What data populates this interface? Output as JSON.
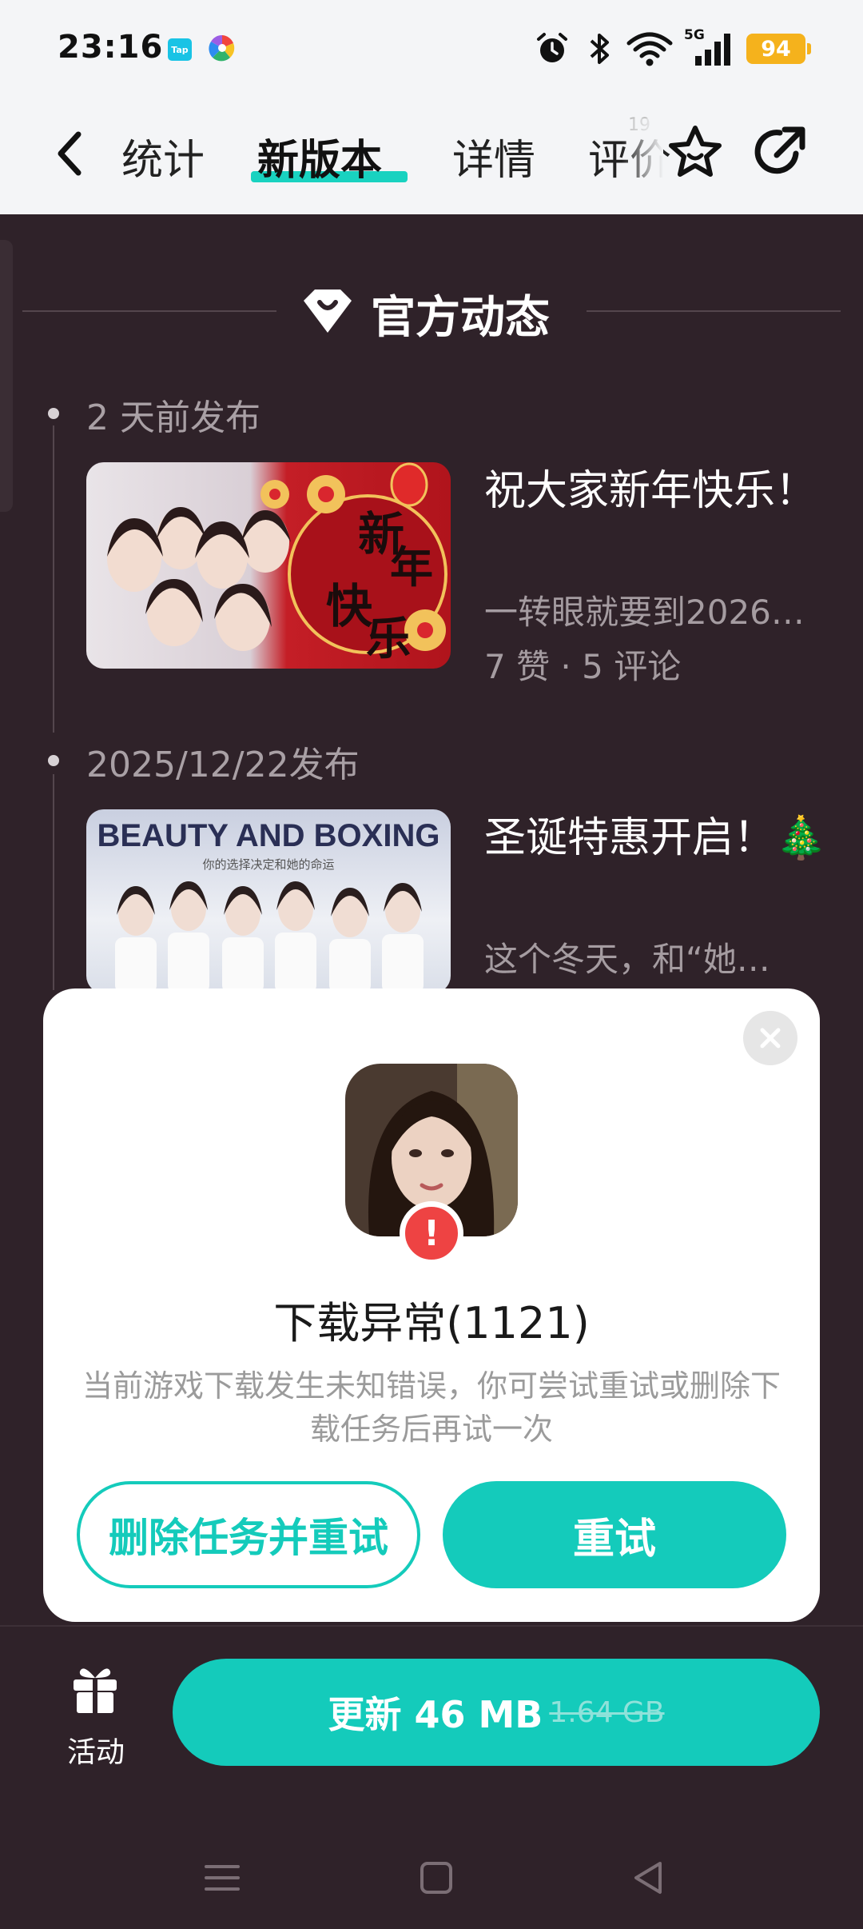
{
  "status_bar": {
    "time": "23:16",
    "notification_icons": [
      "tap-icon",
      "pinwheel-icon"
    ],
    "system_icons": [
      "alarm-icon",
      "bluetooth-icon",
      "wifi-icon",
      "5g-signal-icon"
    ],
    "network_label": "5G",
    "battery": "94",
    "tap_icon_text": "Tap"
  },
  "header": {
    "tabs": [
      {
        "label": "统计",
        "active": false
      },
      {
        "label": "新版本",
        "active": true
      },
      {
        "label": "详情",
        "active": false
      },
      {
        "label": "评价",
        "active": false
      }
    ],
    "tab_badge": "19",
    "accent_color": "#19d2c0"
  },
  "section": {
    "title": "官方动态"
  },
  "posts": [
    {
      "date": "2 天前发布",
      "title": "祝大家新年快乐！",
      "excerpt": "一转眼就要到2026…",
      "meta": "7 赞 · 5 评论",
      "thumb_text": [
        "新",
        "年",
        "快",
        "乐"
      ]
    },
    {
      "date": "2025/12/22发布",
      "title": "圣诞特惠开启！🎄",
      "excerpt": "这个冬天，和“她…",
      "thumb_text": [
        "BEAUTY AND BOXING",
        "你的选择决定和她的命运"
      ]
    }
  ],
  "dialog": {
    "title": "下载异常(1121)",
    "message": "当前游戏下载发生未知错误，你可尝试重试或删除下载任务后再试一次",
    "badge": "!",
    "delete_label": "删除任务并重试",
    "retry_label": "重试"
  },
  "bottom": {
    "activity_label": "活动",
    "update_label": "更新 46 MB",
    "update_old_size": "1.64 GB"
  },
  "nav": {
    "icons": [
      "menu-icon",
      "home-icon",
      "back-icon"
    ]
  }
}
